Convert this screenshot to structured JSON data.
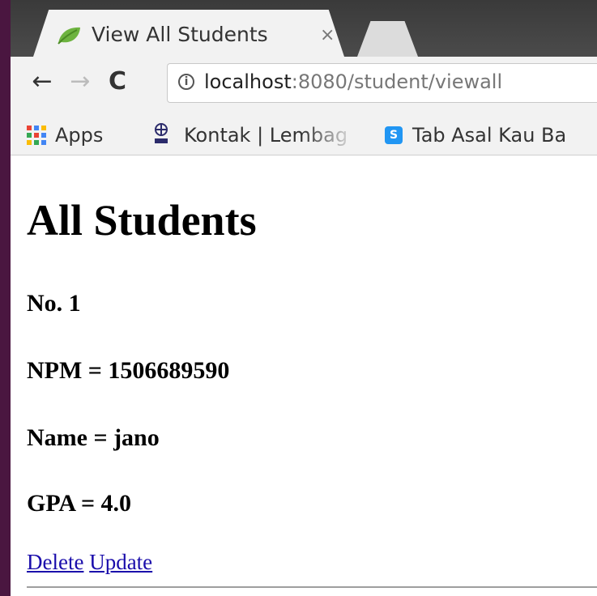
{
  "browser": {
    "tab": {
      "title": "View All Students",
      "close_glyph": "×",
      "favicon": "leaf-icon"
    },
    "nav": {
      "back_glyph": "←",
      "forward_glyph": "→",
      "reload_glyph": "C"
    },
    "address": {
      "info_glyph": "i",
      "host": "localhost",
      "rest": ":8080/student/viewall"
    },
    "bookmarks": [
      {
        "label": "Apps",
        "icon": "apps-grid-icon"
      },
      {
        "label": "Kontak | Lembag",
        "icon": "university-logo-icon"
      },
      {
        "label": "Tab Asal Kau Ba",
        "icon": "tab-app-icon",
        "icon_text": "S"
      }
    ],
    "colors": {
      "titlebar": "#3a3a3a",
      "toolbar": "#f2f2f2",
      "link": "#1a0dab",
      "window_accent": "#4a1640"
    }
  },
  "page": {
    "title": "All Students",
    "students": [
      {
        "number_label": "No. 1",
        "npm_label": "NPM = 1506689590",
        "name_label": "Name = jano",
        "gpa_label": "GPA = 4.0"
      }
    ],
    "actions": {
      "delete_label": "Delete",
      "update_label": "Update"
    }
  }
}
